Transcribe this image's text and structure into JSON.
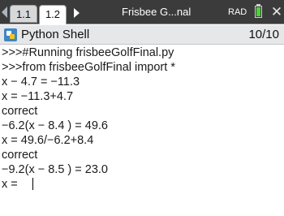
{
  "tabs": [
    {
      "label": "1.1"
    },
    {
      "label": "1.2"
    }
  ],
  "document": {
    "title": "Frisbee G...nal",
    "mode": "RAD"
  },
  "shell": {
    "title": "Python Shell",
    "count": "10/10"
  },
  "console": {
    "lines": [
      ">>>#Running frisbeeGolfFinal.py",
      ">>>from frisbeeGolfFinal import *",
      "x − 4.7 = −11.3",
      "x = −11.3+4.7",
      "correct",
      "−6.2(x − 8.4 ) = 49.6",
      "x = 49.6/−6.2+8.4",
      "correct",
      "−9.2(x − 8.5 ) = 23.0",
      "x ="
    ]
  },
  "icons": {
    "prev_tab": "left-arrow-icon",
    "next_tab": "right-arrow-icon",
    "battery": "battery-icon",
    "close": "close-icon",
    "python": "python-icon"
  },
  "colors": {
    "tabbar_bg": "#3b3b3b",
    "header_bg": "#e6e7e9",
    "battery_fill": "#4cd137"
  }
}
